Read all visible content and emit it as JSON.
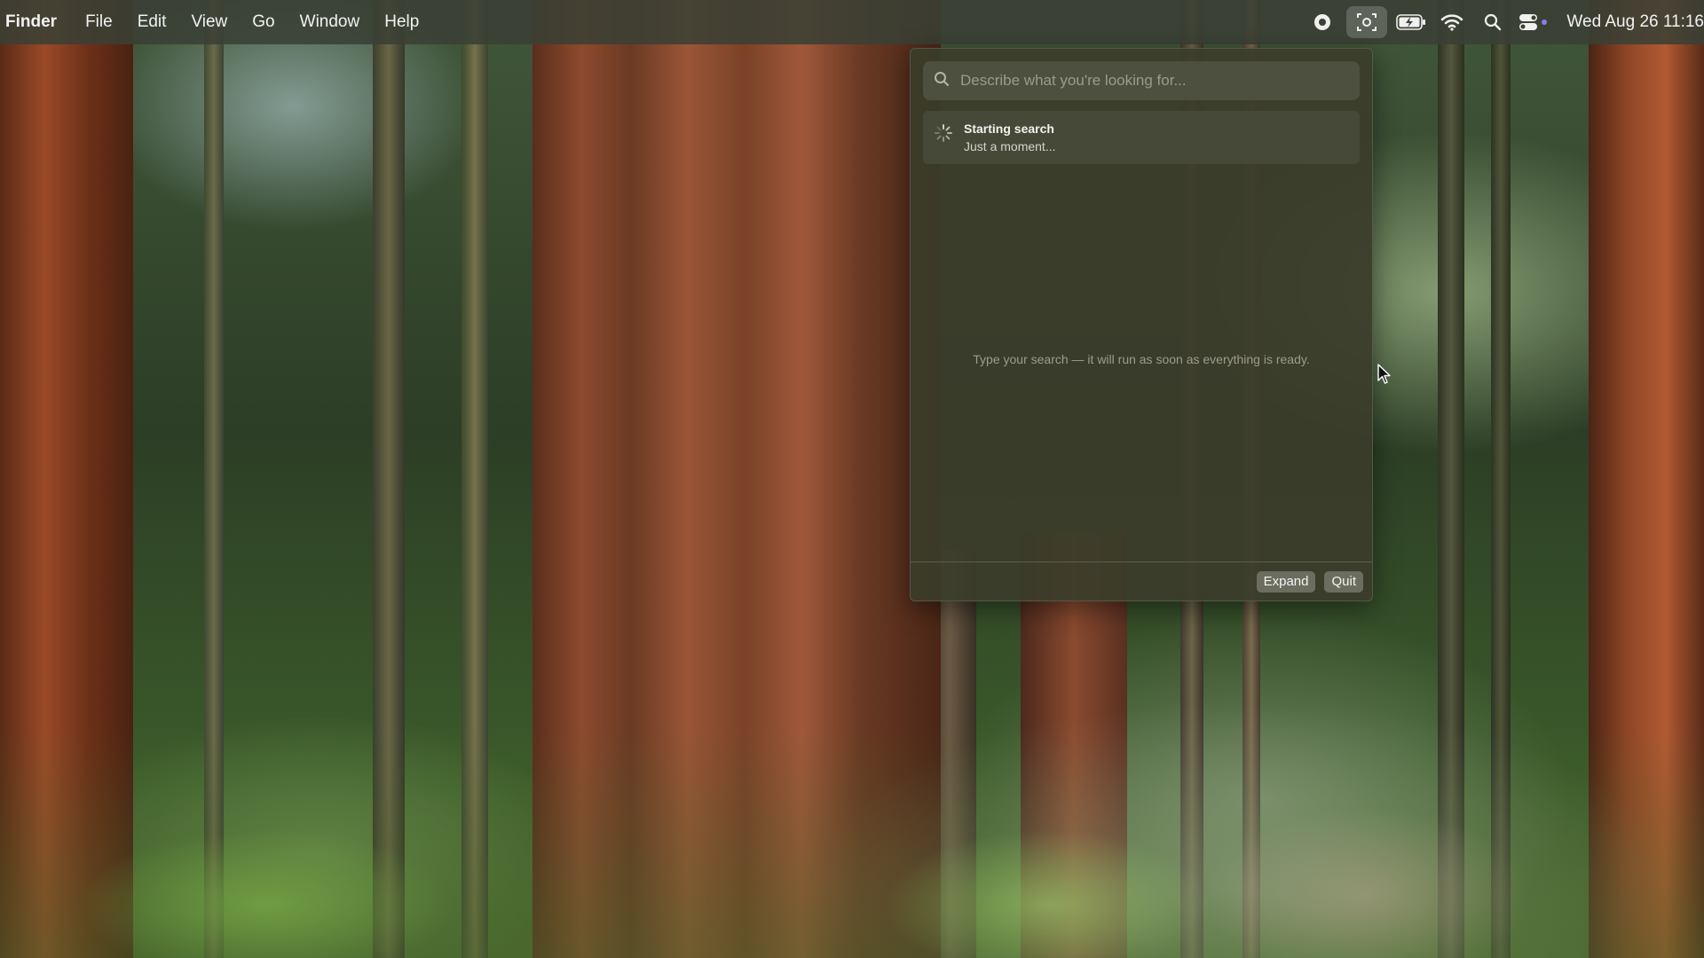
{
  "menubar": {
    "app_name": "Finder",
    "menus": [
      "File",
      "Edit",
      "View",
      "Go",
      "Window",
      "Help"
    ],
    "status_icons": [
      "screen-record-icon",
      "screenshot-icon",
      "battery-charging-icon",
      "wifi-icon",
      "spotlight-search-icon",
      "control-center-icon"
    ],
    "clock": "Wed Aug 26  11:16"
  },
  "search_panel": {
    "placeholder": "Describe what you're looking for...",
    "query": "",
    "status_title": "Starting search",
    "status_subtitle": "Just a moment...",
    "hint": "Type your search — it will run as soon as everything is ready.",
    "expand_label": "Expand",
    "quit_label": "Quit"
  },
  "colors": {
    "panel_bg": "#3a3c2a",
    "menubar_bg": "#3a4034",
    "button_bg": "#6e7062"
  }
}
